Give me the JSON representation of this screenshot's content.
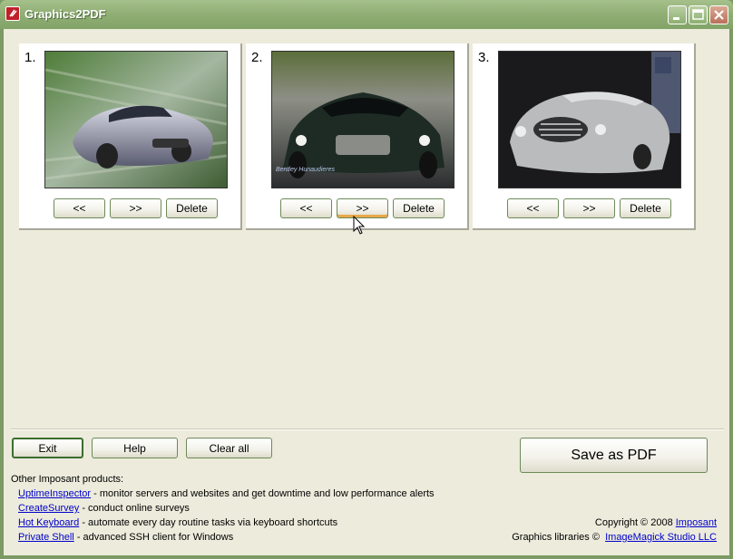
{
  "window": {
    "title": "Graphics2PDF"
  },
  "panels": [
    {
      "number": "1.",
      "prev_label": "<<",
      "next_label": ">>",
      "delete_label": "Delete"
    },
    {
      "number": "2.",
      "prev_label": "<<",
      "next_label": ">>",
      "delete_label": "Delete"
    },
    {
      "number": "3.",
      "prev_label": "<<",
      "next_label": ">>",
      "delete_label": "Delete"
    }
  ],
  "panel2_overlay": "Bentley Hunaudieres",
  "actions": {
    "exit": "Exit",
    "help": "Help",
    "clear_all": "Clear all",
    "save_pdf": "Save as PDF"
  },
  "footer": {
    "heading": "Other Imposant products:",
    "products": [
      {
        "name": "UptimeInspector",
        "desc": " - monitor servers and websites and get downtime and low performance alerts"
      },
      {
        "name": "CreateSurvey",
        "desc": " - conduct online surveys"
      },
      {
        "name": "Hot Keyboard",
        "desc": " - automate every day routine tasks via keyboard shortcuts"
      },
      {
        "name": "Private Shell",
        "desc": " - advanced SSH client for Windows"
      }
    ],
    "copyright_text": "Copyright © 2008",
    "copyright_link": "Imposant",
    "graphics_text": "Graphics libraries ©",
    "graphics_link": "ImageMagick Studio LLC"
  },
  "colors": {
    "titlebar": "#8fae74",
    "client_bg": "#ecebdc",
    "link": "#0000cc",
    "button_border": "#6d8a58"
  }
}
